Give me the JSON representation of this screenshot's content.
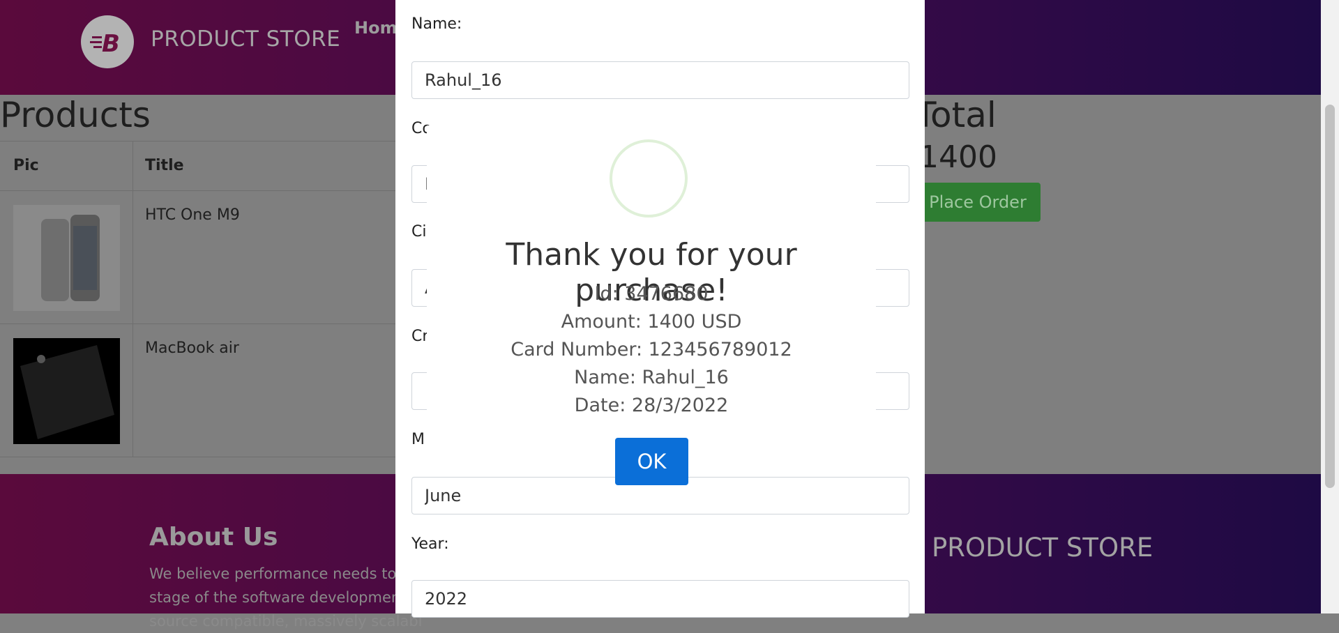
{
  "header": {
    "brand": "PRODUCT STORE",
    "nav_home": "Home"
  },
  "products": {
    "title": "Products",
    "columns": [
      "Pic",
      "Title"
    ],
    "rows": [
      {
        "title": "HTC One M9"
      },
      {
        "title": "MacBook air"
      }
    ]
  },
  "cart": {
    "total_label": "Total",
    "total_value": "1400",
    "place_order_label": "Place Order"
  },
  "footer": {
    "about_title": "About Us",
    "about_lines": [
      "We believe performance needs to be",
      "stage of the software development c",
      "source compatible, massively scalabl"
    ],
    "brand": "PRODUCT STORE"
  },
  "order_form": {
    "name_label": "Name:",
    "name_value": "Rahul_16",
    "country_label": "Co",
    "country_value": "I",
    "city_label": "Ci",
    "city_value": "A",
    "card_label": "Cr",
    "card_value": "",
    "month_label": "M",
    "month_value": "June",
    "year_label": "Year:",
    "year_value": "2022"
  },
  "alert": {
    "title": "Thank you for your purchase!",
    "id_line": "Id: 3476680",
    "amount_line": "Amount: 1400 USD",
    "card_line": "Card Number: 123456789012",
    "name_line": "Name: Rahul_16",
    "date_line": "Date: 28/3/2022",
    "ok_label": "OK",
    "icon": "success-circle-icon",
    "icon_color": "#dff0d8",
    "ok_color": "#0b6fd8"
  },
  "colors": {
    "header_gradient_start": "#5a0a3c",
    "header_gradient_end": "#1e0a44",
    "place_order_green": "#2e7d32"
  }
}
